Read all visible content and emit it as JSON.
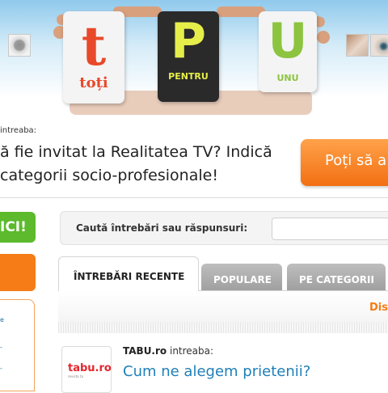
{
  "header": {
    "cards": [
      {
        "big": "t",
        "small": "toți"
      },
      {
        "big": "P",
        "small": "PENTRU"
      },
      {
        "big": "U",
        "small": "UNU"
      }
    ]
  },
  "banner": {
    "asker_suffix": "intreaba:",
    "question_line1": "ă fie invitat la Realitatea TV? Indică",
    "question_line2": "categorii socio-profesionale!",
    "answer_button": "Poți să a"
  },
  "left": {
    "green_button": "ICI!",
    "links": [
      "e",
      "-",
      "-"
    ]
  },
  "search": {
    "label": "Caută întrebări sau răspunsuri:",
    "value": "",
    "placeholder": ""
  },
  "tabs": [
    {
      "label": "ÎNTREBĂRI RECENTE",
      "active": true
    },
    {
      "label": "POPULARE",
      "active": false
    },
    {
      "label": "PE CATEGORII",
      "active": false
    }
  ],
  "content": {
    "discuss_link": "Dis",
    "item": {
      "logo_text": "tabu.ro",
      "logo_sub": "revista ta",
      "asker": "TABU.ro",
      "asker_verb": "intreaba:",
      "question": "Cum ne alegem prietenii?"
    }
  },
  "colors": {
    "accent_orange": "#f57c16",
    "green_button": "#5cba2c",
    "link_blue": "#1f7fb8",
    "header_sky": "#8fc9ec"
  },
  "icons": [
    "flower-thumbnail",
    "avatar-thumbnail",
    "eye-thumbnail"
  ]
}
